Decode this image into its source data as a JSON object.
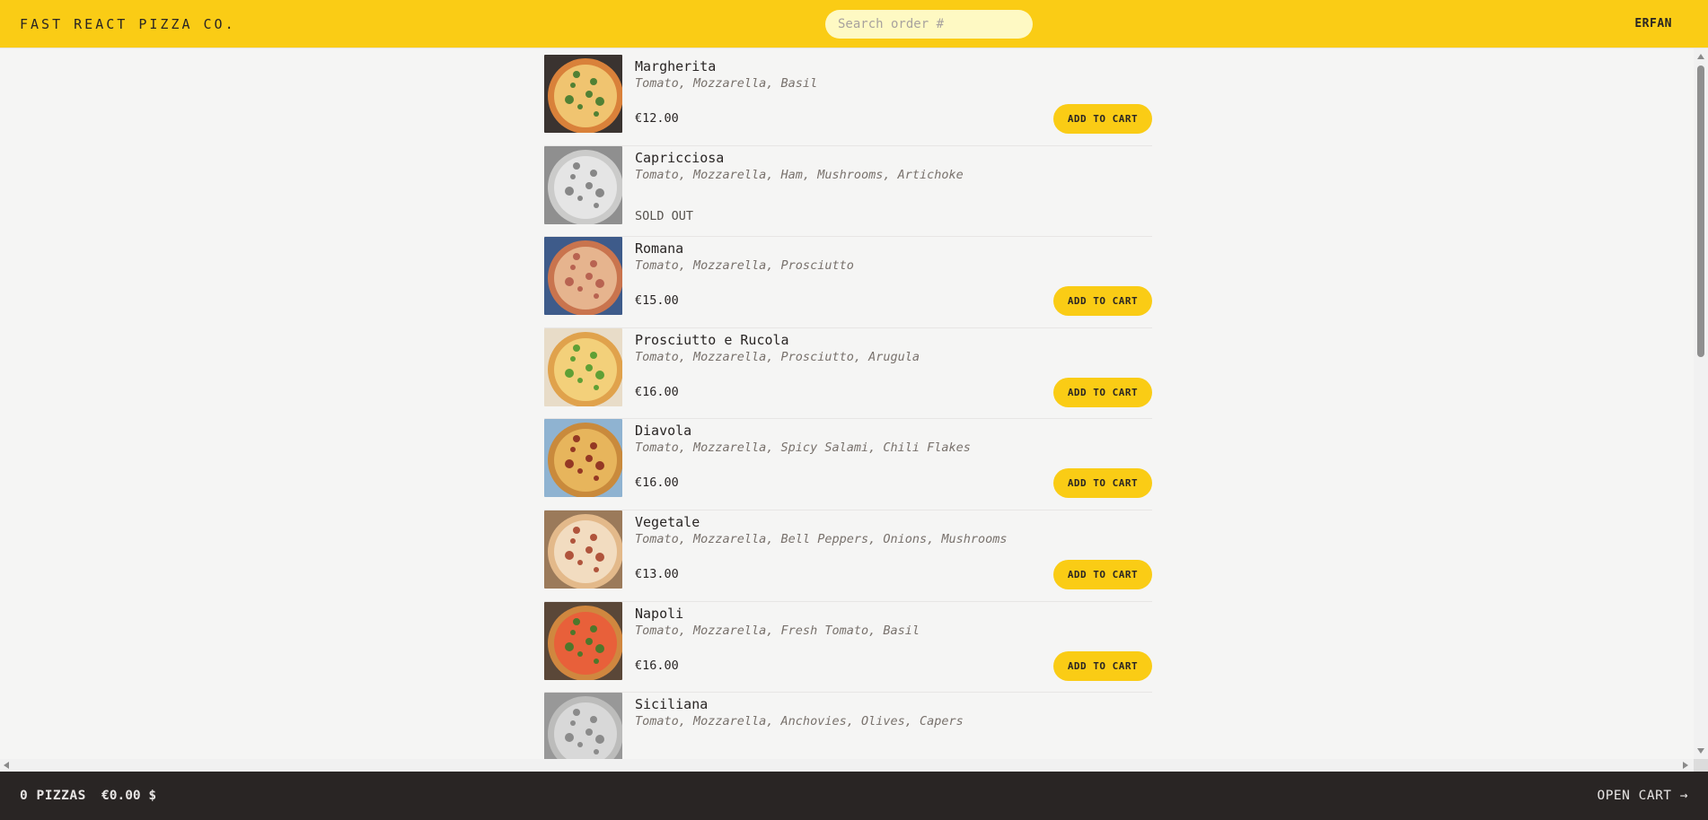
{
  "header": {
    "logo": "FAST REACT PIZZA CO.",
    "search_placeholder": "Search order #",
    "username": "ERFAN"
  },
  "menu": [
    {
      "name": "Margherita",
      "ingredients": "Tomato, Mozzarella, Basil",
      "price": "€12.00",
      "sold_out": false,
      "add_label": "ADD TO CART",
      "image_palette": [
        "#3a3330",
        "#d9813a",
        "#f0c470",
        "#3f7a2e"
      ]
    },
    {
      "name": "Capricciosa",
      "ingredients": "Tomato, Mozzarella, Ham, Mushrooms, Artichoke",
      "price": "",
      "sold_out": true,
      "sold_out_label": "SOLD OUT",
      "image_palette": [
        "#6e6e6e",
        "#bdbdbd",
        "#e0e0e0",
        "#555555"
      ]
    },
    {
      "name": "Romana",
      "ingredients": "Tomato, Mozzarella, Prosciutto",
      "price": "€15.00",
      "sold_out": false,
      "add_label": "ADD TO CART",
      "image_palette": [
        "#3e5b8a",
        "#c9744e",
        "#e6b48e",
        "#b25a4a"
      ]
    },
    {
      "name": "Prosciutto e Rucola",
      "ingredients": "Tomato, Mozzarella, Prosciutto, Arugula",
      "price": "€16.00",
      "sold_out": false,
      "add_label": "ADD TO CART",
      "image_palette": [
        "#e8dcc8",
        "#e0a24c",
        "#f3d07a",
        "#4f9a2e"
      ]
    },
    {
      "name": "Diavola",
      "ingredients": "Tomato, Mozzarella, Spicy Salami, Chili Flakes",
      "price": "€16.00",
      "sold_out": false,
      "add_label": "ADD TO CART",
      "image_palette": [
        "#8fb3d1",
        "#c98a3c",
        "#e7b55c",
        "#8b2a1e"
      ]
    },
    {
      "name": "Vegetale",
      "ingredients": "Tomato, Mozzarella, Bell Peppers, Onions, Mushrooms",
      "price": "€13.00",
      "sold_out": false,
      "add_label": "ADD TO CART",
      "image_palette": [
        "#9b7a5a",
        "#e3b98a",
        "#f2dcc0",
        "#a8452e"
      ]
    },
    {
      "name": "Napoli",
      "ingredients": "Tomato, Mozzarella, Fresh Tomato, Basil",
      "price": "€16.00",
      "sold_out": false,
      "add_label": "ADD TO CART",
      "image_palette": [
        "#5a4738",
        "#d0873f",
        "#e8603a",
        "#3d7a2a"
      ]
    },
    {
      "name": "Siciliana",
      "ingredients": "Tomato, Mozzarella, Anchovies, Olives, Capers",
      "price": "",
      "sold_out": true,
      "sold_out_label": "",
      "image_palette": [
        "#7a7a7a",
        "#a9a9a9",
        "#cfcfcf",
        "#5c5c5c"
      ]
    }
  ],
  "footer": {
    "pizza_count": "0 PIZZAS",
    "total": "€0.00 $",
    "open_cart": "OPEN CART →"
  },
  "colors": {
    "brand_yellow": "#facc15",
    "footer_dark": "#292524",
    "page_background": "#f5f5f4"
  }
}
